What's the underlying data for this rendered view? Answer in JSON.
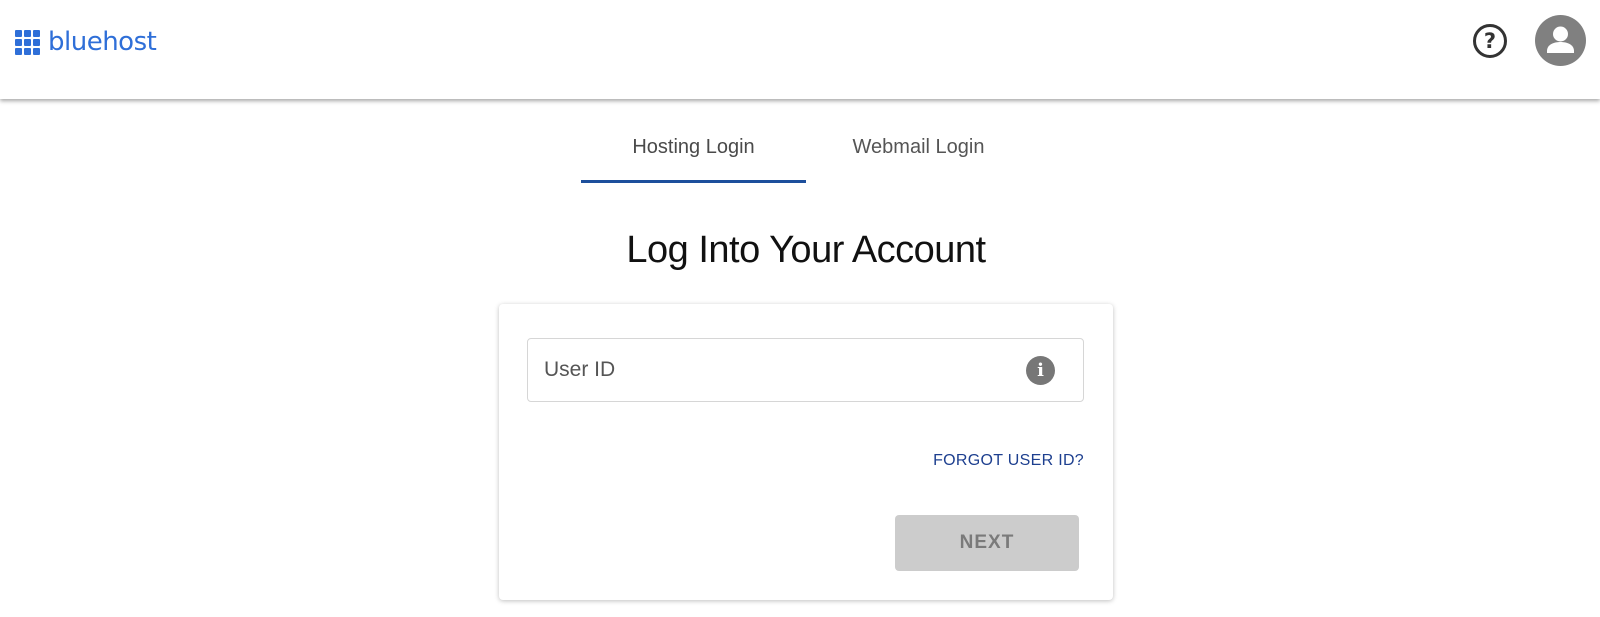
{
  "header": {
    "brand": "bluehost",
    "help_symbol": "?",
    "icons": {
      "logo": "grid-logo-icon",
      "help": "help-circle-icon",
      "avatar": "user-avatar-icon"
    },
    "brand_color": "#2f6fd8"
  },
  "tabs": [
    {
      "label": "Hosting Login",
      "active": true
    },
    {
      "label": "Webmail Login",
      "active": false
    }
  ],
  "main": {
    "title": "Log Into Your Account"
  },
  "form": {
    "user_id_placeholder": "User ID",
    "user_id_value": "",
    "info_symbol": "i",
    "forgot_link": "FORGOT USER ID?",
    "next_button": "NEXT",
    "next_disabled": true
  },
  "colors": {
    "tab_underline": "#1d4f9c",
    "link": "#1d3f8f",
    "button_disabled_bg": "#cccccc",
    "button_disabled_text": "#7a7a7a"
  }
}
